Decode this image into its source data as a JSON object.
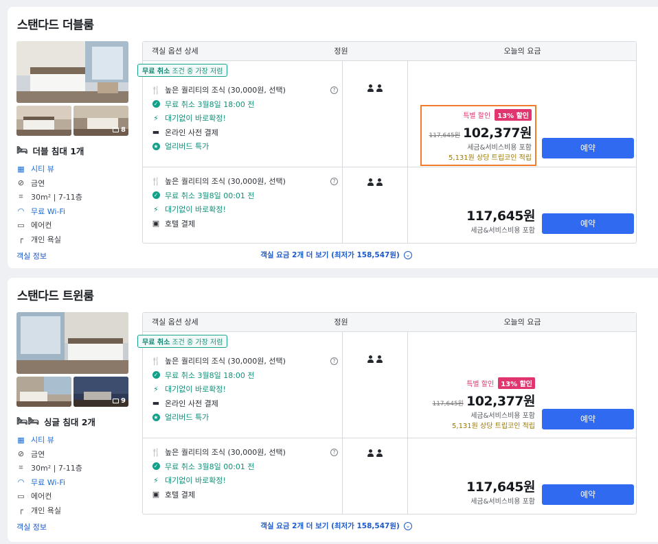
{
  "common": {
    "header_option": "객실 옵션 상세",
    "header_occupancy": "정원",
    "header_price": "오늘의 요금",
    "ribbon_bold": "무료 취소",
    "ribbon_rest": " 조건 중 가장 저렴",
    "reserve_label": "예약",
    "info_label": "객실 정보",
    "more_label": "객실 요금 2개 더 보기 (최저가 158,547원)"
  },
  "rooms": [
    {
      "title": "스탠다드 더블룸",
      "photo_count": "8",
      "bed": "더블 침대 1개",
      "amenities": [
        "시티 뷰",
        "금연",
        "30m² | 7-11층",
        "무료 Wi-Fi",
        "에어컨",
        "개인 욕실"
      ],
      "options": [
        {
          "lines": [
            "높은 퀄리티의 조식 (30,000원, 선택)",
            "무료 취소 3월8일 18:00 전",
            "대기없이 바로확정!",
            "온라인 사전 결제",
            "얼리버드 특가"
          ],
          "badge_special": "특별 할인",
          "badge_discount": "13% 할인",
          "old_price": "117,645원",
          "price": "102,377원",
          "tax": "세금&서비스비용 포함",
          "coin": "5,131원 상당 트립코인 적립"
        },
        {
          "lines": [
            "높은 퀄리티의 조식 (30,000원, 선택)",
            "무료 취소 3월8일 00:01 전",
            "대기없이 바로확정!",
            "호텔 결제"
          ],
          "price": "117,645원",
          "tax": "세금&서비스비용 포함"
        }
      ]
    },
    {
      "title": "스탠다드 트윈룸",
      "photo_count": "9",
      "bed": "싱글 침대 2개",
      "amenities": [
        "시티 뷰",
        "금연",
        "30m² | 7-11층",
        "무료 Wi-Fi",
        "에어컨",
        "개인 욕실"
      ],
      "options": [
        {
          "lines": [
            "높은 퀄리티의 조식 (30,000원, 선택)",
            "무료 취소 3월8일 18:00 전",
            "대기없이 바로확정!",
            "온라인 사전 결제",
            "얼리버드 특가"
          ],
          "badge_special": "특별 할인",
          "badge_discount": "13% 할인",
          "old_price": "117,645원",
          "price": "102,377원",
          "tax": "세금&서비스비용 포함",
          "coin": "5,131원 상당 트립코인 적립"
        },
        {
          "lines": [
            "높은 퀄리티의 조식 (30,000원, 선택)",
            "무료 취소 3월8일 00:01 전",
            "대기없이 바로확정!",
            "호텔 결제"
          ],
          "price": "117,645원",
          "tax": "세금&서비스비용 포함"
        }
      ]
    }
  ],
  "colors": {
    "accent": "#2f6af0",
    "teal": "#13a089",
    "pink": "#e0356f",
    "highlight": "#f07b2a"
  }
}
